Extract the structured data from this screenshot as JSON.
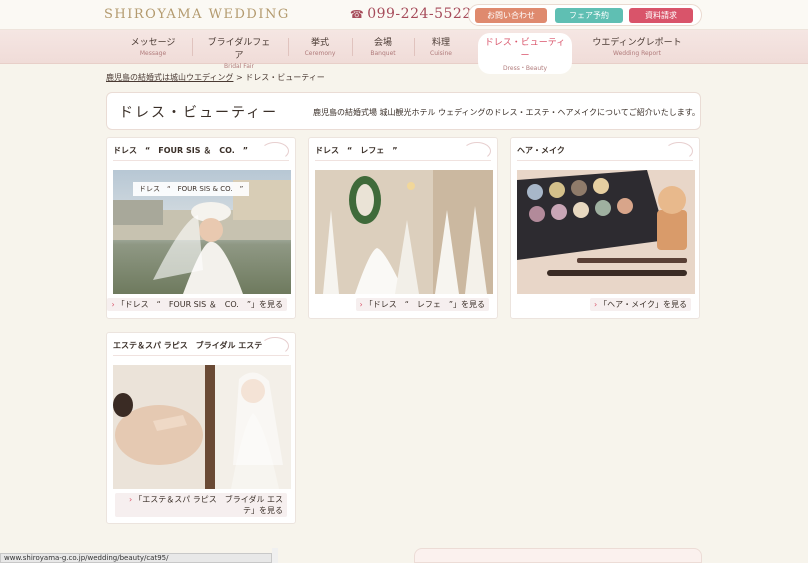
{
  "header": {
    "logo": "SHIROYAMA WEDDING",
    "phone": "099-224-5522",
    "buttons": [
      "お問い合わせ",
      "フェア予約",
      "資料請求"
    ]
  },
  "nav": [
    {
      "jp": "メッセージ",
      "en": "Message"
    },
    {
      "jp": "ブライダルフェア",
      "en": "Bridal Fair"
    },
    {
      "jp": "挙式",
      "en": "Ceremony"
    },
    {
      "jp": "会場",
      "en": "Banquet"
    },
    {
      "jp": "料理",
      "en": "Cuisine"
    },
    {
      "jp": "ドレス・ビューティー",
      "en": "Dress・Beauty"
    },
    {
      "jp": "ウエディングレポート",
      "en": "Wedding Report"
    }
  ],
  "breadcrumb": {
    "home": "鹿児島の結婚式は城山ウエディング",
    "sep": ">",
    "current": "ドレス・ビューティー"
  },
  "page": {
    "title": "ドレス・ビューティー",
    "description": "鹿児島の結婚式場 城山観光ホテル ウェディングのドレス・エステ・ヘアメイクについてご紹介いたします。"
  },
  "cards": [
    {
      "title": "ドレス　“　FOUR SIS ＆　CO.　”",
      "photo_label": "ドレス　“　FOUR SIS & CO.　”",
      "link": "「ドレス　“　FOUR SIS ＆　CO.　”」を見る"
    },
    {
      "title": "ドレス　“　レフェ　”",
      "link": "「ドレス　“　レフェ　”」を見る"
    },
    {
      "title": "ヘア・メイク",
      "link": "「ヘア・メイク」を見る"
    },
    {
      "title": "エステ＆スパ ラピス　ブライダル エステ",
      "link": "「エステ＆スパ ラピス　ブライダル エステ」を見る"
    }
  ],
  "status": {
    "url": "www.shiroyama-g.co.jp/wedding/beauty/cat95/"
  }
}
